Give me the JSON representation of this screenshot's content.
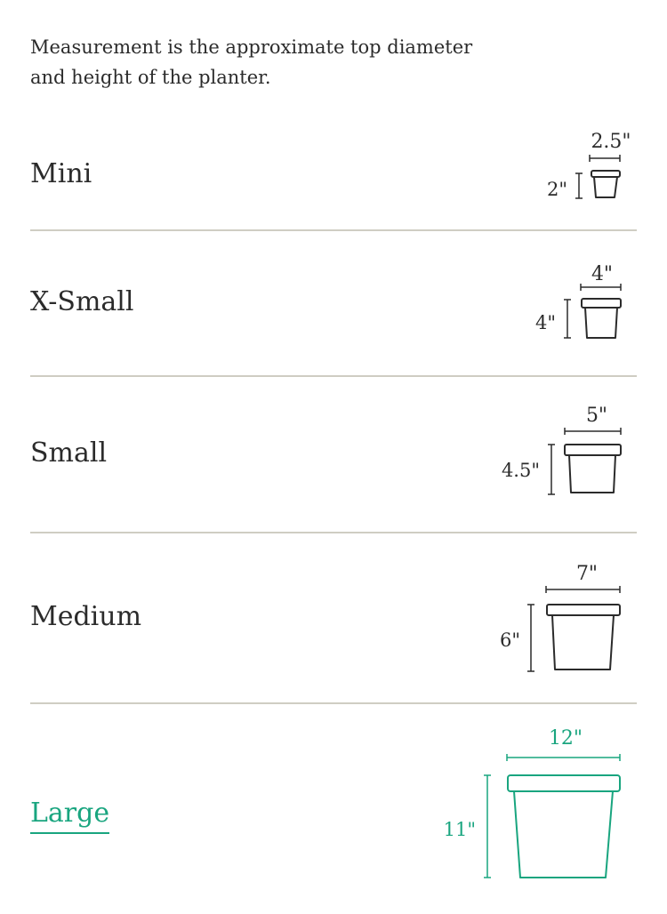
{
  "intro": "Measurement is the approximate top diameter and height of the planter.",
  "colors": {
    "text": "#2b2b2b",
    "selected": "#19a57f",
    "divider": "#cfcdc3",
    "line": "#2b2b2b"
  },
  "sizes": [
    {
      "label": "Mini",
      "diameter": "2.5\"",
      "height": "2\"",
      "selected": false
    },
    {
      "label": "X-Small",
      "diameter": "4\"",
      "height": "4\"",
      "selected": false
    },
    {
      "label": "Small",
      "diameter": "5\"",
      "height": "4.5\"",
      "selected": false
    },
    {
      "label": "Medium",
      "diameter": "7\"",
      "height": "6\"",
      "selected": false
    },
    {
      "label": "Large",
      "diameter": "12\"",
      "height": "11\"",
      "selected": true
    }
  ],
  "icons": {
    "planter": "planter-icon"
  }
}
